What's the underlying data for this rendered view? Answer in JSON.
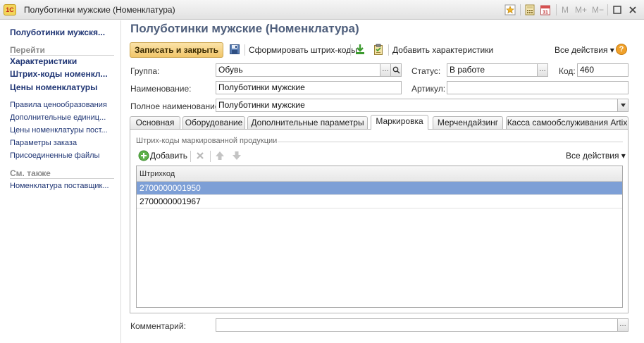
{
  "window": {
    "title": "Полуботинки мужские (Номенклатура)",
    "app_logo": "1С",
    "toolbar_m": "M",
    "toolbar_mplus": "M+",
    "toolbar_mminus": "M−"
  },
  "sidebar": {
    "title": "Полуботинки мужскя...",
    "go_section": "Перейти",
    "bold_items": [
      "Характеристики",
      "Штрих-коды номенкл...",
      "Цены номенклатуры"
    ],
    "links": [
      "Правила ценообразования",
      "Дополнительные единиц...",
      "Цены номенклатуры пост...",
      "Параметры заказа",
      "Присоединенные файлы"
    ],
    "see_also_section": "См. также",
    "see_also_links": [
      "Номенклатура поставщик..."
    ]
  },
  "form": {
    "title": "Полуботинки мужские (Номенклатура)",
    "save_close_label": "Записать и закрыть",
    "generate_barcodes_label": "Сформировать штрих-коды",
    "add_characteristics_label": "Добавить характеристики",
    "all_actions_label": "Все действия ▾",
    "help_label": "?",
    "group_label": "Группа:",
    "group_value": "Обувь",
    "status_label": "Статус:",
    "status_value": "В работе",
    "code_label": "Код:",
    "code_value": "460",
    "name_label": "Наименование:",
    "name_value": "Полуботинки мужские",
    "article_label": "Артикул:",
    "article_value": "",
    "full_name_label": "Полное наименование:",
    "full_name_value": "Полуботинки мужские",
    "comment_label": "Комментарий:",
    "comment_value": ""
  },
  "tabs": [
    "Основная",
    "Оборудование",
    "Дополнительные параметры",
    "Маркировка",
    "Мерчендайзинг",
    "Касса самообслуживания Artix"
  ],
  "marking": {
    "group_title": "Штрих-коды маркированной продукции",
    "add_label": "Добавить",
    "all_actions_label": "Все действия ▾",
    "column_header": "Штрихкод",
    "rows": [
      "2700000001950",
      "2700000001967"
    ]
  },
  "colors": {
    "accent_title": "#4f5f7c",
    "sidebar_link": "#1f3574",
    "primary_button": "#f1c66a",
    "row_selected": "#7d9fd6"
  }
}
